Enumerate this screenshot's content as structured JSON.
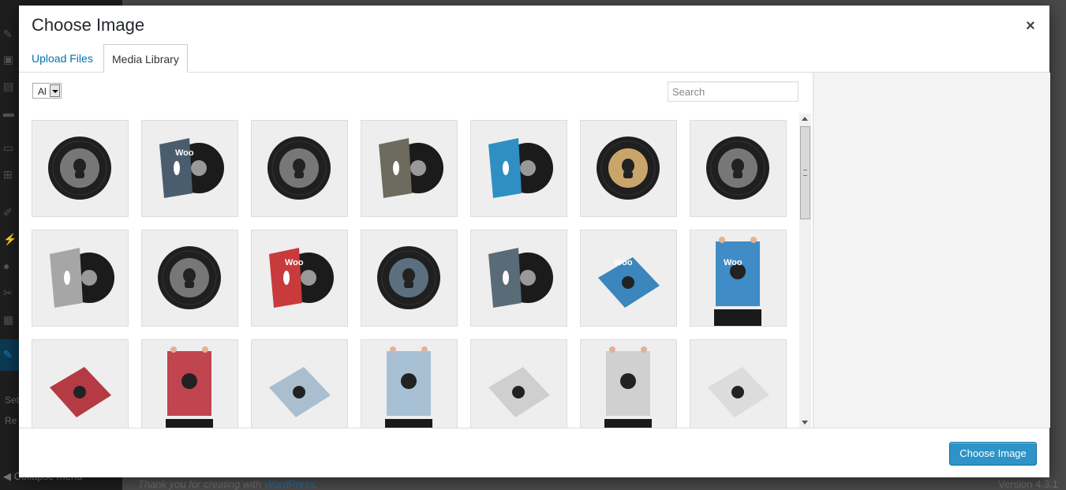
{
  "background": {
    "sidebar": {
      "submenu_items": [
        "Set",
        "Re"
      ],
      "collapse_label": "Collapse menu"
    },
    "footer": {
      "thanks_prefix": "Thank you for creating with ",
      "thanks_link": "WordPress",
      "thanks_suffix": ".",
      "version": "Version 4.3.1"
    }
  },
  "modal": {
    "title": "Choose Image",
    "close_glyph": "×",
    "tabs": {
      "upload": "Upload Files",
      "library": "Media Library"
    },
    "filter": {
      "selected": "Al"
    },
    "search": {
      "placeholder": "Search",
      "value": ""
    },
    "action_button": "Choose Image",
    "colors": {
      "link": "#0073aa",
      "primary": "#2e93c6"
    },
    "thumbnails": [
      {
        "kind": "record",
        "label_color": "#777777"
      },
      {
        "kind": "record-sleeve",
        "sleeve_color": "#4a5d6e",
        "text": "Woo"
      },
      {
        "kind": "record",
        "label_color": "#777777"
      },
      {
        "kind": "record-sleeve",
        "sleeve_color": "#6d6a5e"
      },
      {
        "kind": "record-sleeve",
        "sleeve_color": "#2f8fc2"
      },
      {
        "kind": "record",
        "label_color": "#c9a56b"
      },
      {
        "kind": "record",
        "label_color": "#777777"
      },
      {
        "kind": "record-sleeve",
        "sleeve_color": "#a6a6a6"
      },
      {
        "kind": "record",
        "label_color": "#777777"
      },
      {
        "kind": "record-sleeve",
        "sleeve_color": "#c93a3c",
        "text": "Woo"
      },
      {
        "kind": "record",
        "label_color": "#5b6f7e"
      },
      {
        "kind": "record-sleeve",
        "sleeve_color": "#5a6b78"
      },
      {
        "kind": "poster-tilted",
        "poster_color": "#3a86bd",
        "text": "Woo"
      },
      {
        "kind": "poster-held",
        "poster_color": "#3f8cc6",
        "text": "Woo"
      },
      {
        "kind": "poster-tilted",
        "poster_color": "#b43a44"
      },
      {
        "kind": "poster-held",
        "poster_color": "#c0454f"
      },
      {
        "kind": "poster-tilted",
        "poster_color": "#a9bfcf"
      },
      {
        "kind": "poster-held",
        "poster_color": "#a8c0d3"
      },
      {
        "kind": "poster-tilted",
        "poster_color": "#cfcfcf"
      },
      {
        "kind": "poster-held",
        "poster_color": "#d0d0d0"
      },
      {
        "kind": "poster-tilted",
        "poster_color": "#dcdcdc"
      }
    ]
  }
}
